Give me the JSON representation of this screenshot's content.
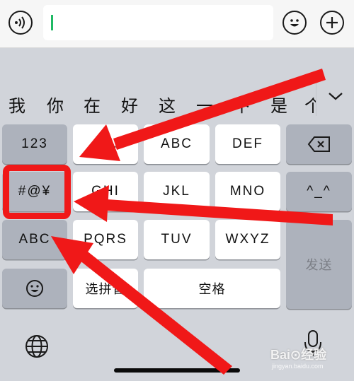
{
  "input_bar": {
    "voice_icon": "voice-wave-icon",
    "emoji_icon": "smile-face-icon",
    "plus_icon": "plus-circle-icon",
    "text_value": ""
  },
  "candidates": [
    "我",
    "你",
    "在",
    "好",
    "这",
    "一",
    "下",
    "是",
    "个"
  ],
  "candidate_toggle_icon": "chevron-down-icon",
  "keys": {
    "num": "123",
    "symbols": "#@¥",
    "abc_left": "ABC",
    "emoji_icon": "smile-face-icon",
    "k1": "@/.",
    "k2": "ABC",
    "k3": "DEF",
    "k4": "GHI",
    "k5": "JKL",
    "k6": "MNO",
    "k7": "PQRS",
    "k8": "TUV",
    "k9": "WXYZ",
    "select_pinyin": "选拼音",
    "space": "空格",
    "backspace_icon": "backspace-icon",
    "kaomoji": "^_^",
    "send": "发送"
  },
  "bottom": {
    "globe_icon": "globe-icon",
    "mic_icon": "microphone-icon"
  },
  "watermark": {
    "text": "Bai⊙经验",
    "sub": "jingyan.baidu.com"
  },
  "colors": {
    "annotation_red": "#f01818",
    "caret_green": "#1fb964"
  }
}
